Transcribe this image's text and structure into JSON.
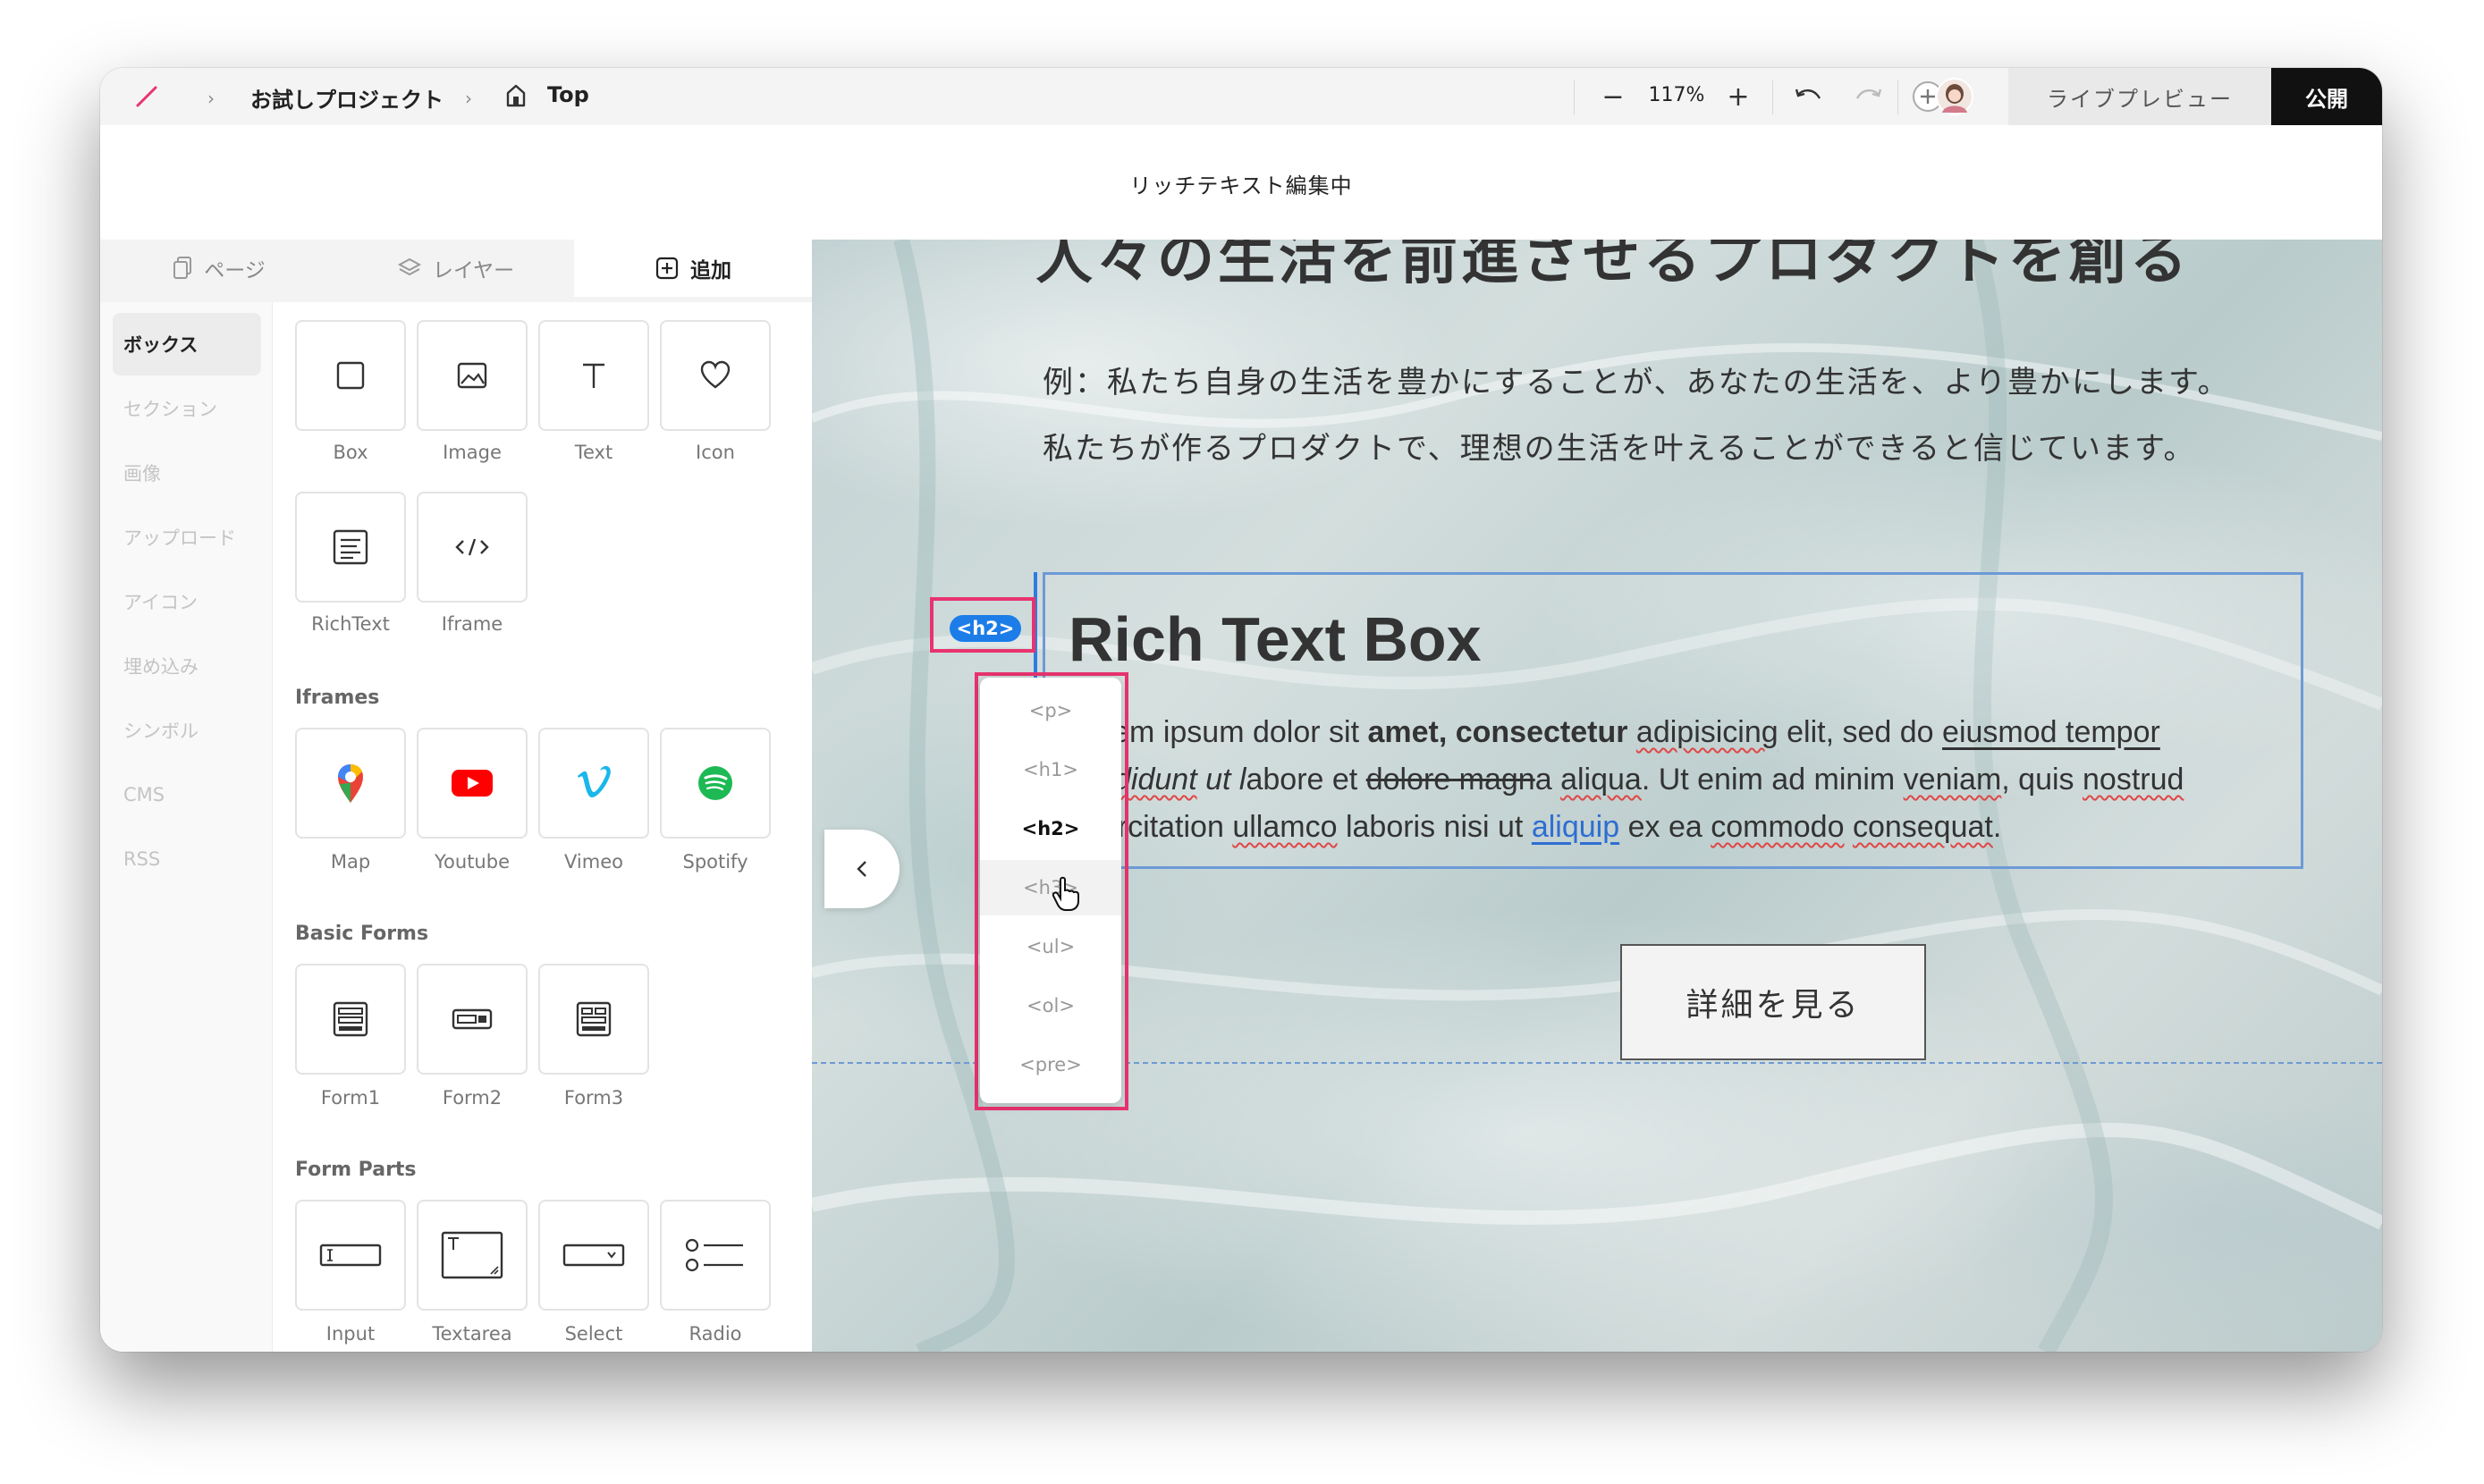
{
  "topbar": {
    "project_name": "お試しプロジェクト",
    "page_name": "Top",
    "zoom": "117%",
    "live_preview_label": "ライブプレビュー",
    "publish_label": "公開"
  },
  "mode_title": "リッチテキスト編集中",
  "panel": {
    "tabs": [
      {
        "label": "ページ",
        "active": false
      },
      {
        "label": "レイヤー",
        "active": false
      },
      {
        "label": "追加",
        "active": true
      }
    ],
    "categories": [
      {
        "label": "ボックス",
        "active": true
      },
      {
        "label": "セクション"
      },
      {
        "label": "画像"
      },
      {
        "label": "アップロード"
      },
      {
        "label": "アイコン"
      },
      {
        "label": "埋め込み"
      },
      {
        "label": "シンボル"
      },
      {
        "label": "CMS"
      },
      {
        "label": "RSS"
      }
    ],
    "box_items": [
      "Box",
      "Image",
      "Text",
      "Icon",
      "RichText",
      "Iframe"
    ],
    "iframes_heading": "Iframes",
    "iframe_items": [
      "Map",
      "Youtube",
      "Vimeo",
      "Spotify"
    ],
    "basic_forms_heading": "Basic Forms",
    "form_items": [
      "Form1",
      "Form2",
      "Form3"
    ],
    "form_parts_heading": "Form Parts",
    "form_part_items": [
      "Input",
      "Textarea",
      "Select",
      "Radio"
    ]
  },
  "canvas": {
    "hero_title_partial": "人々の生活を前進させるプロダクトを創る",
    "hero_desc_1": "例：私たち自身の生活を豊かにすることが、あなたの生活を、より豊かにします。",
    "hero_desc_2": "私たちが作るプロダクトで、理想の生活を叶えることができると信じています。",
    "rich_text": {
      "title": "Rich Text Box",
      "t1": "Lorem ipsum dolor sit ",
      "t2": "amet, consectetur",
      "t3": " ",
      "t4": "adipisicing",
      "t5": " elit, sed do ",
      "t6": "eiusmod",
      "t7": " ",
      "t8": "tempor",
      "t9": "incididunt",
      "t10": " ut ",
      "t11": "l",
      "t12": "abore et ",
      "t13": "dolore magn",
      "t14": "a ",
      "t15": "aliqua",
      "t16": ". Ut enim ad minim ",
      "t17": "veniam",
      "t18": ", quis ",
      "t19": "nostrud",
      "t20": "exercitation",
      "t21": " ",
      "t22": "ullamco",
      "t23": " laboris nisi ut ",
      "t24": "aliquip",
      "t25": " ex ea ",
      "t26": "commodo",
      "t27": " ",
      "t28": "consequat",
      "t29": "."
    },
    "detail_button": "詳細を見る",
    "current_tag": "<h2>",
    "tag_options": [
      {
        "label": "<p>"
      },
      {
        "label": "<h1>"
      },
      {
        "label": "<h2>",
        "selected": true
      },
      {
        "label": "<h3>",
        "hovered": true
      },
      {
        "label": "<ul>"
      },
      {
        "label": "<ol>"
      },
      {
        "label": "<pre>"
      }
    ],
    "help_label": "?"
  },
  "colors": {
    "accent_pink": "#e8336f",
    "tag_blue": "#1d7de8",
    "selection_blue": "#6c9ad6",
    "publish_bg": "#111111"
  }
}
